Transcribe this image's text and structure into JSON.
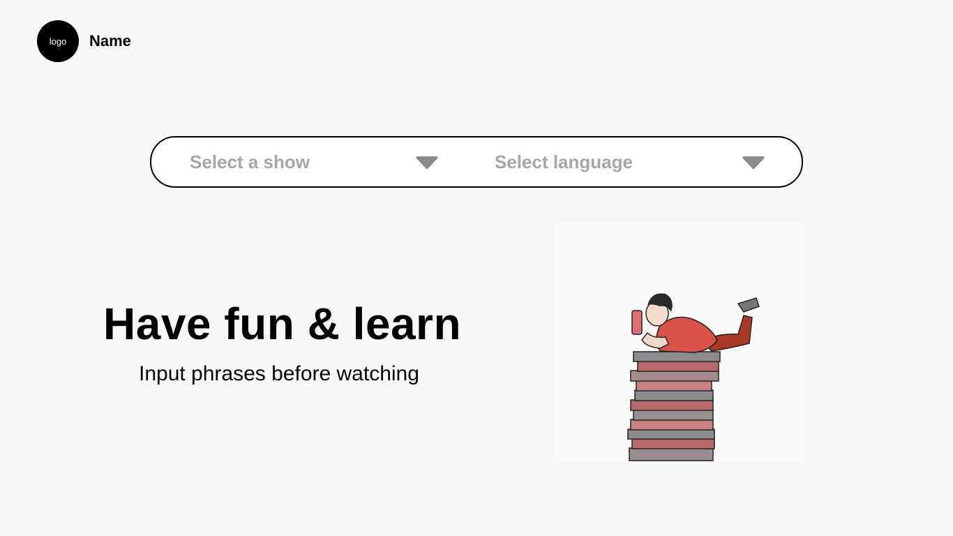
{
  "header": {
    "logo_text": "logo",
    "brand_name": "Name"
  },
  "selectors": {
    "show": {
      "label": "Select a show",
      "icon": "chevron-down-icon"
    },
    "language": {
      "label": "Select language",
      "icon": "chevron-down-icon"
    }
  },
  "hero": {
    "title": "Have fun & learn",
    "subtitle": "Input phrases before watching"
  },
  "illustration": {
    "description_icon": "person-on-books-illustration"
  },
  "colors": {
    "background": "#f8f8f6",
    "text": "#000000",
    "placeholder": "#a6a6a6",
    "caret": "#8a8a8a",
    "shirt": "#d9534a",
    "books_red": "#b86a6a",
    "books_gray": "#8c8c8c"
  }
}
